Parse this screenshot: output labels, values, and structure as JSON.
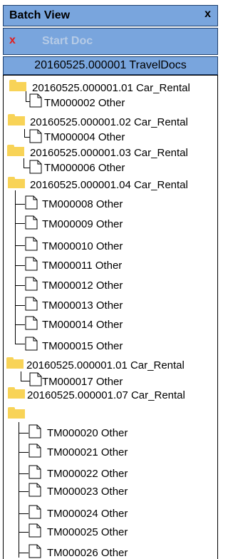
{
  "header": {
    "title": "Batch View",
    "close_glyph": "x"
  },
  "toolbar": {
    "close_glyph": "x",
    "start_doc_label": "Start Doc"
  },
  "batch": {
    "label": "20160525.000001 TravelDocs"
  },
  "colors": {
    "header_bg": "#79a5dd",
    "folder_yellow": "#f8d357",
    "close_red": "#e41d1d",
    "disabled_text": "#b6cbe6"
  },
  "tree": {
    "folders": [
      {
        "label": "20160525.000001.01 Car_Rental"
      },
      {
        "label": "20160525.000001.02 Car_Rental"
      },
      {
        "label": "20160525.000001.03 Car_Rental"
      },
      {
        "label": "20160525.000001.04 Car_Rental"
      },
      {
        "label": "20160525.000001.01 Car_Rental"
      },
      {
        "label": "20160525.000001.07 Car_Rental"
      },
      {
        "label": ""
      }
    ],
    "docs": [
      {
        "label": "TM000002 Other"
      },
      {
        "label": "TM000004 Other"
      },
      {
        "label": "TM000006 Other"
      },
      {
        "label": "TM000008 Other"
      },
      {
        "label": "TM000009 Other"
      },
      {
        "label": "TM000010 Other"
      },
      {
        "label": "TM000011 Other"
      },
      {
        "label": "TM000012 Other"
      },
      {
        "label": "TM000013 Other"
      },
      {
        "label": "TM000014 Other"
      },
      {
        "label": "TM000015 Other"
      },
      {
        "label": "TM000017 Other"
      },
      {
        "label": "TM000020 Other"
      },
      {
        "label": "TM000021 Other"
      },
      {
        "label": "TM000022 Other"
      },
      {
        "label": "TM000023 Other"
      },
      {
        "label": "TM000024 Other"
      },
      {
        "label": "TM000025 Other"
      },
      {
        "label": "TM000026 Other"
      }
    ]
  }
}
